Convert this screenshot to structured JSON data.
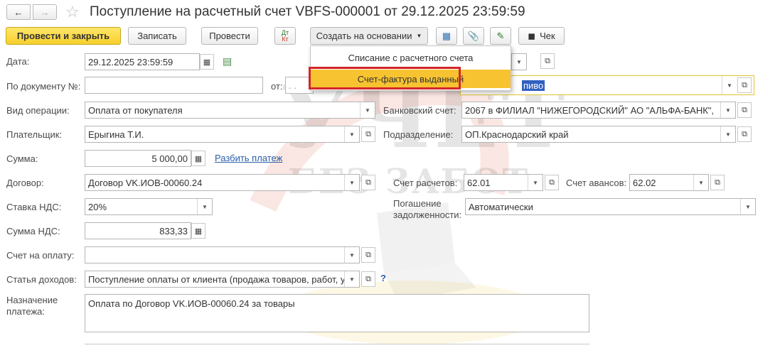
{
  "title": "Поступление на расчетный счет VBFS-000001 от 29.12.2025 23:59:59",
  "toolbar": {
    "post_close": "Провести и закрыть",
    "save": "Записать",
    "post": "Провести",
    "dtkt_top": "Дт",
    "dtkt_bottom": "Кт",
    "create_basis": "Создать на основании",
    "check": "Чек"
  },
  "menu": {
    "items": [
      "Списание с расчетного счета",
      "Счет-фактура выданный"
    ],
    "selected_index": 1
  },
  "form": {
    "date_label": "Дата:",
    "date_value": "29.12.2025 23:59:59",
    "doc_no_label": "По документу №:",
    "doc_no_value": "",
    "from_label": "от:",
    "from_value": ". .",
    "org_partial": "пиво",
    "op_type_label": "Вид операции:",
    "op_type_value": "Оплата от покупателя",
    "bank_account_label": "Банковский счет:",
    "bank_account_value": "2067 в ФИЛИАЛ \"НИЖЕГОРОДСКИЙ\" АО \"АЛЬФА-БАНК\",",
    "payer_label": "Плательщик:",
    "payer_value": "Ерыгина Т.И.",
    "division_label": "Подразделение:",
    "division_value": "ОП.Краснодарский край",
    "sum_label": "Сумма:",
    "sum_value": "5 000,00",
    "split_link": "Разбить платеж",
    "contract_label": "Договор:",
    "contract_value": "Договор VK.ИОВ-00060.24",
    "settlement_account_label": "Счет расчетов:",
    "settlement_account_value": "62.01",
    "advance_account_label": "Счет авансов:",
    "advance_account_value": "62.02",
    "vat_rate_label": "Ставка НДС:",
    "vat_rate_value": "20%",
    "debt_repayment_label_1": "Погашение",
    "debt_repayment_label_2": "задолженности:",
    "debt_repayment_value": "Автоматически",
    "vat_sum_label": "Сумма НДС:",
    "vat_sum_value": "833,33",
    "invoice_label": "Счет на оплату:",
    "invoice_value": "",
    "income_item_label": "Статья доходов:",
    "income_item_value": "Поступление оплаты от клиента (продажа товаров, работ, ус",
    "purpose_label_1": "Назначение",
    "purpose_label_2": "платежа:",
    "purpose_value": "Оплата по Договор VK.ИОВ-00060.24 за товары"
  },
  "watermark": {
    "line1": "УЧЕТ",
    "line2": "БЕЗ ЗАБОТ"
  }
}
